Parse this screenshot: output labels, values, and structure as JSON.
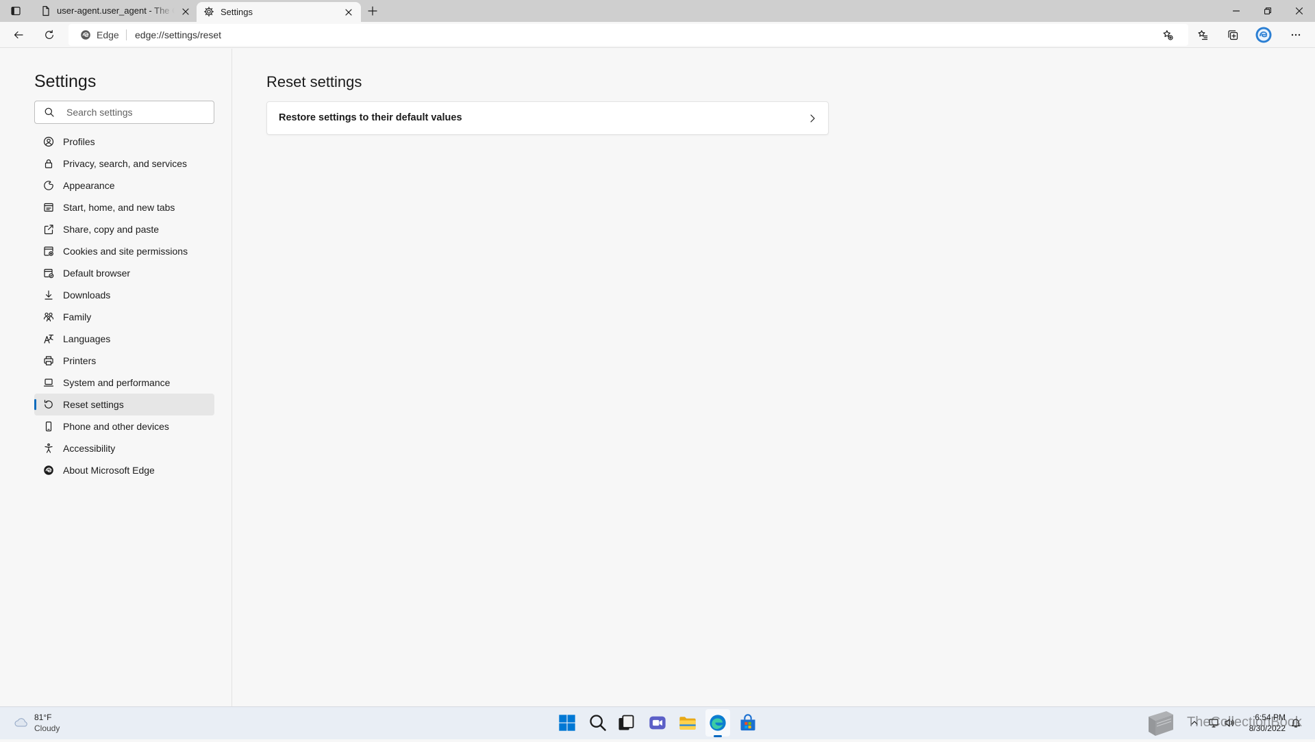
{
  "window": {
    "controls": [
      "minimize-icon",
      "restore-icon",
      "close-icon"
    ]
  },
  "tabs": [
    {
      "title": "user-agent.user_agent - The Col",
      "icon": "document-icon",
      "active": false
    },
    {
      "title": "Settings",
      "icon": "gear-icon",
      "active": true
    }
  ],
  "address_bar": {
    "site_label": "Edge",
    "url": "edge://settings/reset"
  },
  "toolbar_icons": [
    "back-icon",
    "refresh-icon",
    "add-favorite-icon",
    "favorites-icon",
    "collections-icon",
    "profile-avatar-icon",
    "more-icon"
  ],
  "sidebar": {
    "title": "Settings",
    "search": {
      "placeholder": "Search settings",
      "value": ""
    },
    "selected_index": 12,
    "items": [
      {
        "label": "Profiles",
        "icon": "profile-icon"
      },
      {
        "label": "Privacy, search, and services",
        "icon": "lock-icon"
      },
      {
        "label": "Appearance",
        "icon": "palette-icon"
      },
      {
        "label": "Start, home, and new tabs",
        "icon": "home-tabs-icon"
      },
      {
        "label": "Share, copy and paste",
        "icon": "share-icon"
      },
      {
        "label": "Cookies and site permissions",
        "icon": "cookies-icon"
      },
      {
        "label": "Default browser",
        "icon": "default-browser-icon"
      },
      {
        "label": "Downloads",
        "icon": "download-icon"
      },
      {
        "label": "Family",
        "icon": "family-icon"
      },
      {
        "label": "Languages",
        "icon": "languages-icon"
      },
      {
        "label": "Printers",
        "icon": "printer-icon"
      },
      {
        "label": "System and performance",
        "icon": "laptop-icon"
      },
      {
        "label": "Reset settings",
        "icon": "reset-icon",
        "selected": true
      },
      {
        "label": "Phone and other devices",
        "icon": "phone-icon"
      },
      {
        "label": "Accessibility",
        "icon": "accessibility-icon"
      },
      {
        "label": "About Microsoft Edge",
        "icon": "edge-logo-icon"
      }
    ]
  },
  "main": {
    "heading": "Reset settings",
    "options": [
      {
        "label": "Restore settings to their default values",
        "icon": "chevron-right-icon"
      }
    ]
  },
  "taskbar": {
    "weather": {
      "temperature": "81°F",
      "condition": "Cloudy",
      "icon": "cloudy-weather-icon"
    },
    "apps": [
      {
        "icon": "windows-start-icon",
        "active": false
      },
      {
        "icon": "search-icon",
        "active": false
      },
      {
        "icon": "task-view-icon",
        "active": false
      },
      {
        "icon": "chat-icon",
        "active": false
      },
      {
        "icon": "file-explorer-icon",
        "active": false
      },
      {
        "icon": "edge-browser-icon",
        "active": true
      },
      {
        "icon": "store-icon",
        "active": false
      }
    ],
    "tray_icons": [
      "chevron-up-icon",
      "network-icon",
      "volume-icon",
      "notification-icon"
    ],
    "clock": {
      "time": "6:54 PM",
      "date": "8/30/2022"
    }
  },
  "watermark": {
    "text": "TheCollectionBook",
    "icon": "book-icon"
  },
  "colors": {
    "accent": "#0f6cbd",
    "page_bg": "#f7f7f7",
    "card_bg": "#ffffff",
    "tab_strip_bg": "#cfcfcf",
    "taskbar_bg": "#e9eef5"
  }
}
